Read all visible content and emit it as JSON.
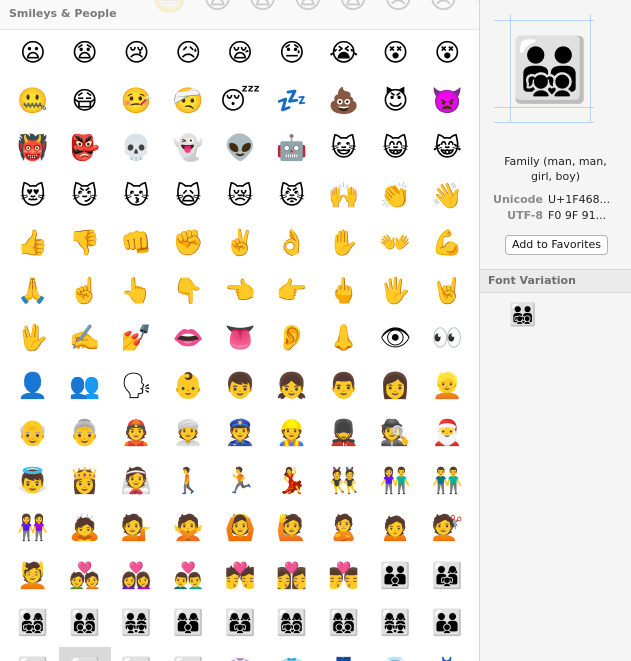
{
  "section": {
    "title": "Smileys & People",
    "ghost_row": "😬😧😨😩😨😢😣😤"
  },
  "grid": {
    "rows": [
      [
        "😦",
        "😧",
        "😢",
        "😥",
        "😪",
        "😓",
        "😭",
        "😵",
        "😵"
      ],
      [
        "🤐",
        "😷",
        "🤒",
        "🤕",
        "😴",
        "💤",
        "💩",
        "😈",
        "👿"
      ],
      [
        "👹",
        "👺",
        "💀",
        "👻",
        "👽",
        "🤖",
        "😺",
        "😸",
        "😹"
      ],
      [
        "😻",
        "😼",
        "😽",
        "🙀",
        "😿",
        "😾",
        "🙌",
        "👏",
        "👋"
      ],
      [
        "👍",
        "👎",
        "👊",
        "✊",
        "✌️",
        "👌",
        "✋",
        "👐",
        "💪"
      ],
      [
        "🙏",
        "☝️",
        "👆",
        "👇",
        "👈",
        "👉",
        "🖕",
        "🖐",
        "🤘"
      ],
      [
        "🖖",
        "✍️",
        "💅",
        "👄",
        "👅",
        "👂",
        "👃",
        "👁",
        "👀"
      ],
      [
        "👤",
        "👥",
        "🗣",
        "👶",
        "👦",
        "👧",
        "👨",
        "👩",
        "👱"
      ],
      [
        "👴",
        "👵",
        "👲",
        "👳",
        "👮",
        "👷",
        "💂",
        "🕵",
        "🎅"
      ],
      [
        "👼",
        "👸",
        "👰",
        "🚶",
        "🏃",
        "💃",
        "👯",
        "👫",
        "👬"
      ],
      [
        "👭",
        "🙇",
        "💁",
        "🙅",
        "🙆",
        "🙋",
        "🙎",
        "🙍",
        "💇"
      ],
      [
        "💆",
        "💑",
        "👩‍❤️‍👩",
        "👨‍❤️‍👨",
        "💏",
        "👩‍❤️‍💋‍👩",
        "👨‍❤️‍💋‍👨",
        "👪",
        "👨‍👩‍👧"
      ],
      [
        "👨‍👩‍👧‍👦",
        "👨‍👩‍👦‍👦",
        "👨‍👩‍👧‍👧",
        "👩‍👩‍👦",
        "👩‍👩‍👧",
        "👩‍👩‍👧‍👦",
        "👩‍👩‍👦‍👦",
        "👩‍👩‍👧‍👧",
        "👨‍👨‍👦"
      ],
      [
        "👨‍👨‍👧",
        "👨‍👨‍👧‍👦",
        "👨‍👨‍👦‍👦",
        "👨‍👨‍👧‍👧",
        "👚",
        "👕",
        "👖",
        "👔",
        "👗"
      ]
    ],
    "selected_row": 13,
    "selected_col": 1
  },
  "detail": {
    "preview_glyph": "👨‍👨‍👧‍👦",
    "name_line1": "Family (man, man,",
    "name_line2": "girl, boy)",
    "unicode_label": "Unicode",
    "unicode_value": "U+1F468...",
    "utf8_label": "UTF-8",
    "utf8_value": "F0 9F 91...",
    "add_favorites_label": "Add to Favorites"
  },
  "variations": {
    "title": "Font Variation",
    "items": [
      "👨‍👨‍👧‍👦"
    ]
  },
  "colors": {
    "selected_bg": "#d9d9d9",
    "guide_line": "#b8d4ee",
    "panel_bg": "#f5f5f5",
    "header_text": "#7a7a7a"
  }
}
